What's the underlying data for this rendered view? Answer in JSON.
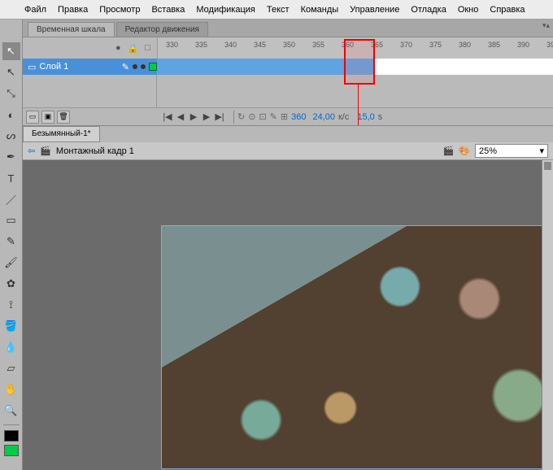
{
  "app_icon": "FL",
  "menu": [
    "Файл",
    "Правка",
    "Просмотр",
    "Вставка",
    "Модификация",
    "Текст",
    "Команды",
    "Управление",
    "Отладка",
    "Окно",
    "Справка"
  ],
  "panels": {
    "timeline_tab": "Временная шкала",
    "motion_tab": "Редактор движения"
  },
  "timeline": {
    "layer_name": "Слой 1",
    "ruler_start": 330,
    "ruler_step": 5,
    "ruler_count": 14,
    "highlight_frame": 360,
    "footer": {
      "frame": "360",
      "fps": "24,00",
      "fps_unit": "к/с",
      "time": "15,0",
      "time_unit": "s"
    }
  },
  "doc": {
    "tab": "Безымянный-1*",
    "scene_label": "Монтажный кадр 1",
    "zoom": "25%"
  },
  "tools": [
    "arrow",
    "subselect",
    "free-transform",
    "3d-rotate",
    "lasso",
    "pen",
    "text",
    "line",
    "rect",
    "pencil",
    "brush",
    "deco",
    "bone",
    "paint-bucket",
    "ink",
    "eraser",
    "hand",
    "zoom"
  ],
  "colors": {
    "stroke": "#000000",
    "fill": "#00cc44"
  },
  "icons": {
    "eye": "●",
    "lock": "🔒",
    "outline": "□",
    "page": "▭",
    "pencil": "✎",
    "folder_new": "▣",
    "delete": "🗑",
    "first": "|◀",
    "prev": "◀",
    "play": "▶",
    "next": "▶",
    "last": "▶|",
    "loop": "↻",
    "onion": "⊙",
    "onion2": "⊡",
    "edit": "✎",
    "center": "⊞",
    "clapper": "🎬",
    "palette": "🎨",
    "back": "⇦",
    "collapse": "▾▴"
  }
}
